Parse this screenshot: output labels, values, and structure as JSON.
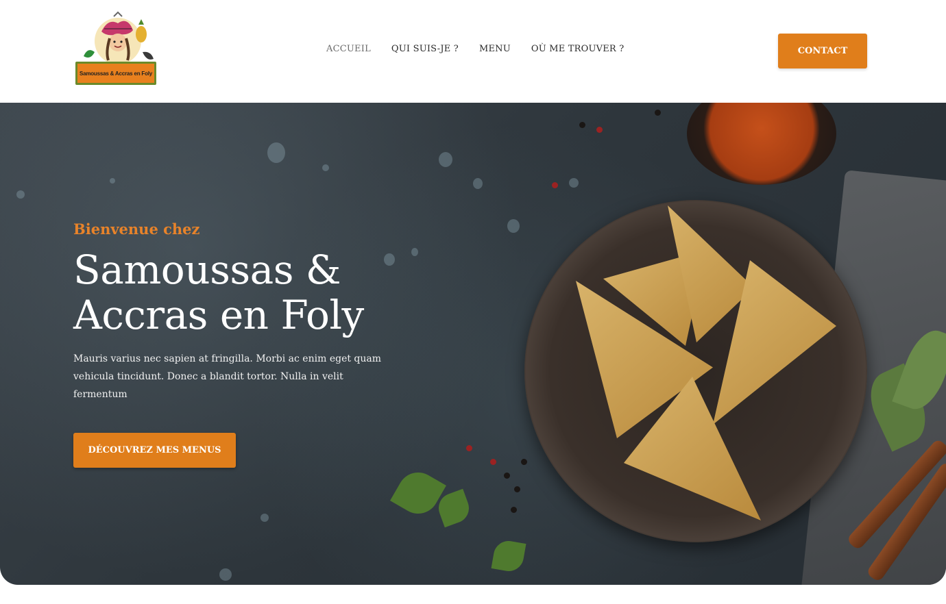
{
  "logo": {
    "text": "Samoussas & Accras en Foly",
    "icon": "chef-mascot-logo"
  },
  "nav": {
    "items": [
      {
        "label": "ACCUEIL",
        "active": true
      },
      {
        "label": "QUI SUIS-JE ?",
        "active": false
      },
      {
        "label": "MENU",
        "active": false
      },
      {
        "label": "OÙ ME TROUVER ?",
        "active": false
      }
    ],
    "contact_label": "CONTACT"
  },
  "hero": {
    "eyebrow": "Bienvenue chez",
    "title_line1": "Samoussas &",
    "title_line2": "Accras en Foly",
    "description": "Mauris varius nec sapien at fringilla. Morbi ac enim eget quam vehicula tincidunt. Donec a blandit tortor. Nulla in velit fermentum",
    "cta_label": "DÉCOUVREZ MES MENUS",
    "image": "samosas-bowl-photo"
  },
  "colors": {
    "accent": "#e07e1b",
    "accent_text": "#e8832a",
    "hero_bg": "#2e363c"
  }
}
